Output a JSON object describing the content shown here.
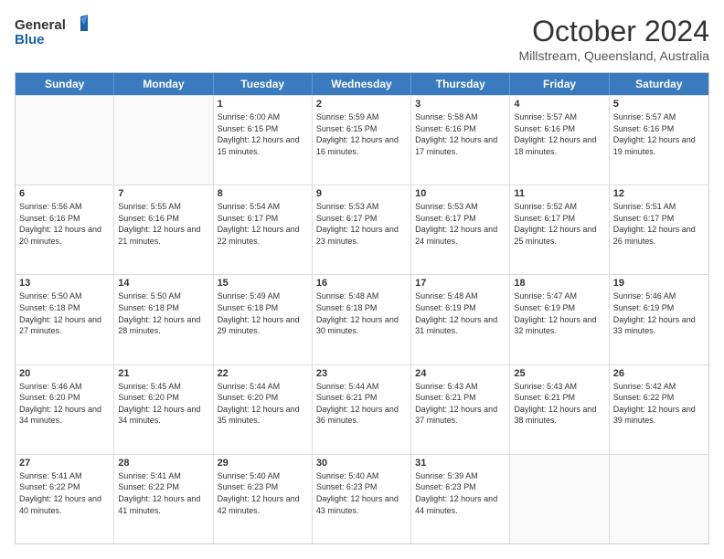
{
  "header": {
    "logo_line1": "General",
    "logo_line2": "Blue",
    "month": "October 2024",
    "location": "Millstream, Queensland, Australia"
  },
  "weekdays": [
    "Sunday",
    "Monday",
    "Tuesday",
    "Wednesday",
    "Thursday",
    "Friday",
    "Saturday"
  ],
  "rows": [
    [
      {
        "day": "",
        "info": ""
      },
      {
        "day": "",
        "info": ""
      },
      {
        "day": "1",
        "info": "Sunrise: 6:00 AM\nSunset: 6:15 PM\nDaylight: 12 hours and 15 minutes."
      },
      {
        "day": "2",
        "info": "Sunrise: 5:59 AM\nSunset: 6:15 PM\nDaylight: 12 hours and 16 minutes."
      },
      {
        "day": "3",
        "info": "Sunrise: 5:58 AM\nSunset: 6:16 PM\nDaylight: 12 hours and 17 minutes."
      },
      {
        "day": "4",
        "info": "Sunrise: 5:57 AM\nSunset: 6:16 PM\nDaylight: 12 hours and 18 minutes."
      },
      {
        "day": "5",
        "info": "Sunrise: 5:57 AM\nSunset: 6:16 PM\nDaylight: 12 hours and 19 minutes."
      }
    ],
    [
      {
        "day": "6",
        "info": "Sunrise: 5:56 AM\nSunset: 6:16 PM\nDaylight: 12 hours and 20 minutes."
      },
      {
        "day": "7",
        "info": "Sunrise: 5:55 AM\nSunset: 6:16 PM\nDaylight: 12 hours and 21 minutes."
      },
      {
        "day": "8",
        "info": "Sunrise: 5:54 AM\nSunset: 6:17 PM\nDaylight: 12 hours and 22 minutes."
      },
      {
        "day": "9",
        "info": "Sunrise: 5:53 AM\nSunset: 6:17 PM\nDaylight: 12 hours and 23 minutes."
      },
      {
        "day": "10",
        "info": "Sunrise: 5:53 AM\nSunset: 6:17 PM\nDaylight: 12 hours and 24 minutes."
      },
      {
        "day": "11",
        "info": "Sunrise: 5:52 AM\nSunset: 6:17 PM\nDaylight: 12 hours and 25 minutes."
      },
      {
        "day": "12",
        "info": "Sunrise: 5:51 AM\nSunset: 6:17 PM\nDaylight: 12 hours and 26 minutes."
      }
    ],
    [
      {
        "day": "13",
        "info": "Sunrise: 5:50 AM\nSunset: 6:18 PM\nDaylight: 12 hours and 27 minutes."
      },
      {
        "day": "14",
        "info": "Sunrise: 5:50 AM\nSunset: 6:18 PM\nDaylight: 12 hours and 28 minutes."
      },
      {
        "day": "15",
        "info": "Sunrise: 5:49 AM\nSunset: 6:18 PM\nDaylight: 12 hours and 29 minutes."
      },
      {
        "day": "16",
        "info": "Sunrise: 5:48 AM\nSunset: 6:18 PM\nDaylight: 12 hours and 30 minutes."
      },
      {
        "day": "17",
        "info": "Sunrise: 5:48 AM\nSunset: 6:19 PM\nDaylight: 12 hours and 31 minutes."
      },
      {
        "day": "18",
        "info": "Sunrise: 5:47 AM\nSunset: 6:19 PM\nDaylight: 12 hours and 32 minutes."
      },
      {
        "day": "19",
        "info": "Sunrise: 5:46 AM\nSunset: 6:19 PM\nDaylight: 12 hours and 33 minutes."
      }
    ],
    [
      {
        "day": "20",
        "info": "Sunrise: 5:46 AM\nSunset: 6:20 PM\nDaylight: 12 hours and 34 minutes."
      },
      {
        "day": "21",
        "info": "Sunrise: 5:45 AM\nSunset: 6:20 PM\nDaylight: 12 hours and 34 minutes."
      },
      {
        "day": "22",
        "info": "Sunrise: 5:44 AM\nSunset: 6:20 PM\nDaylight: 12 hours and 35 minutes."
      },
      {
        "day": "23",
        "info": "Sunrise: 5:44 AM\nSunset: 6:21 PM\nDaylight: 12 hours and 36 minutes."
      },
      {
        "day": "24",
        "info": "Sunrise: 5:43 AM\nSunset: 6:21 PM\nDaylight: 12 hours and 37 minutes."
      },
      {
        "day": "25",
        "info": "Sunrise: 5:43 AM\nSunset: 6:21 PM\nDaylight: 12 hours and 38 minutes."
      },
      {
        "day": "26",
        "info": "Sunrise: 5:42 AM\nSunset: 6:22 PM\nDaylight: 12 hours and 39 minutes."
      }
    ],
    [
      {
        "day": "27",
        "info": "Sunrise: 5:41 AM\nSunset: 6:22 PM\nDaylight: 12 hours and 40 minutes."
      },
      {
        "day": "28",
        "info": "Sunrise: 5:41 AM\nSunset: 6:22 PM\nDaylight: 12 hours and 41 minutes."
      },
      {
        "day": "29",
        "info": "Sunrise: 5:40 AM\nSunset: 6:23 PM\nDaylight: 12 hours and 42 minutes."
      },
      {
        "day": "30",
        "info": "Sunrise: 5:40 AM\nSunset: 6:23 PM\nDaylight: 12 hours and 43 minutes."
      },
      {
        "day": "31",
        "info": "Sunrise: 5:39 AM\nSunset: 6:23 PM\nDaylight: 12 hours and 44 minutes."
      },
      {
        "day": "",
        "info": ""
      },
      {
        "day": "",
        "info": ""
      }
    ]
  ]
}
